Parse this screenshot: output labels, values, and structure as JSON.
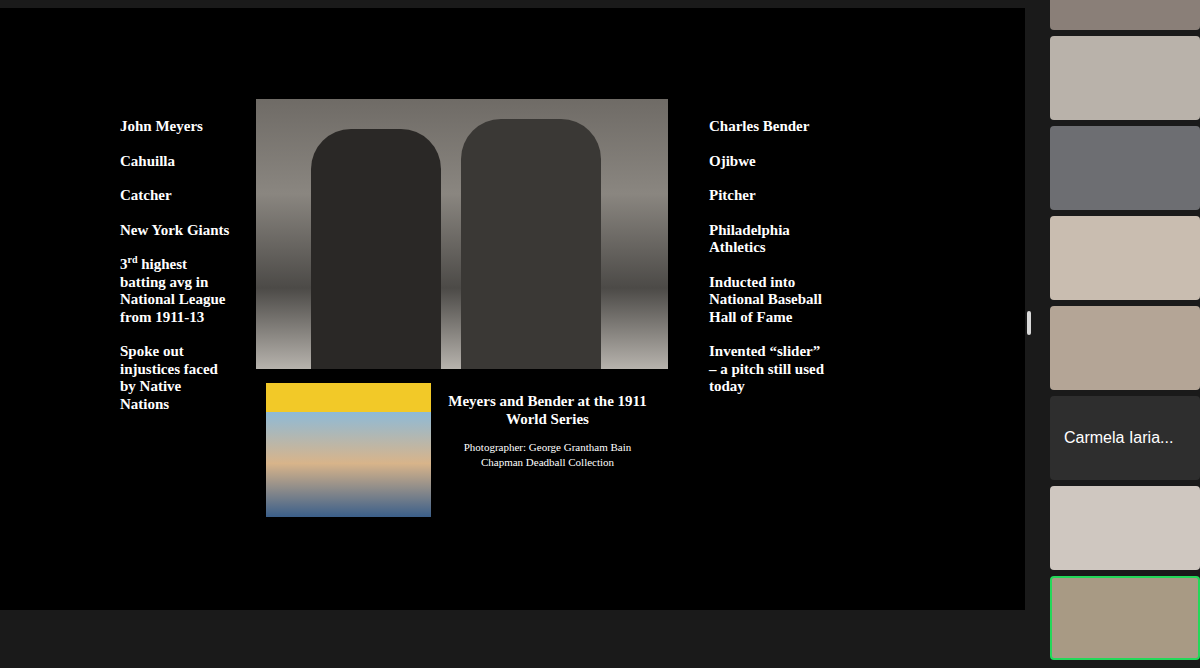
{
  "slide": {
    "left_facts": [
      {
        "text": "John Meyers"
      },
      {
        "text": "Cahuilla"
      },
      {
        "text": "Catcher"
      },
      {
        "text": "New York Giants"
      },
      {
        "lead": "3",
        "sup": "rd",
        "text": " highest batting avg in National League from 1911-13"
      },
      {
        "text": "Spoke out injustices faced by Native Nations"
      }
    ],
    "right_facts": [
      {
        "text": "Charles Bender"
      },
      {
        "text": "Ojibwe"
      },
      {
        "text": "Pitcher"
      },
      {
        "text": "Philadelphia Athletics"
      },
      {
        "text": "Inducted into National Baseball Hall of Fame"
      },
      {
        "text": "Invented “slider” – a pitch still used today"
      }
    ],
    "photo_caption": "Meyers and Bender at the 1911 World Series",
    "credits": [
      "Photographer: George Grantham Bain",
      "Chapman Deadball Collection"
    ]
  },
  "participants": [
    {
      "kind": "video",
      "selected": false
    },
    {
      "kind": "video",
      "selected": false
    },
    {
      "kind": "video",
      "selected": false
    },
    {
      "kind": "video",
      "selected": false
    },
    {
      "kind": "video",
      "selected": false
    },
    {
      "kind": "name-card",
      "name": "Carmela Iaria...",
      "selected": false
    },
    {
      "kind": "video",
      "selected": false
    },
    {
      "kind": "video",
      "selected": true
    }
  ]
}
